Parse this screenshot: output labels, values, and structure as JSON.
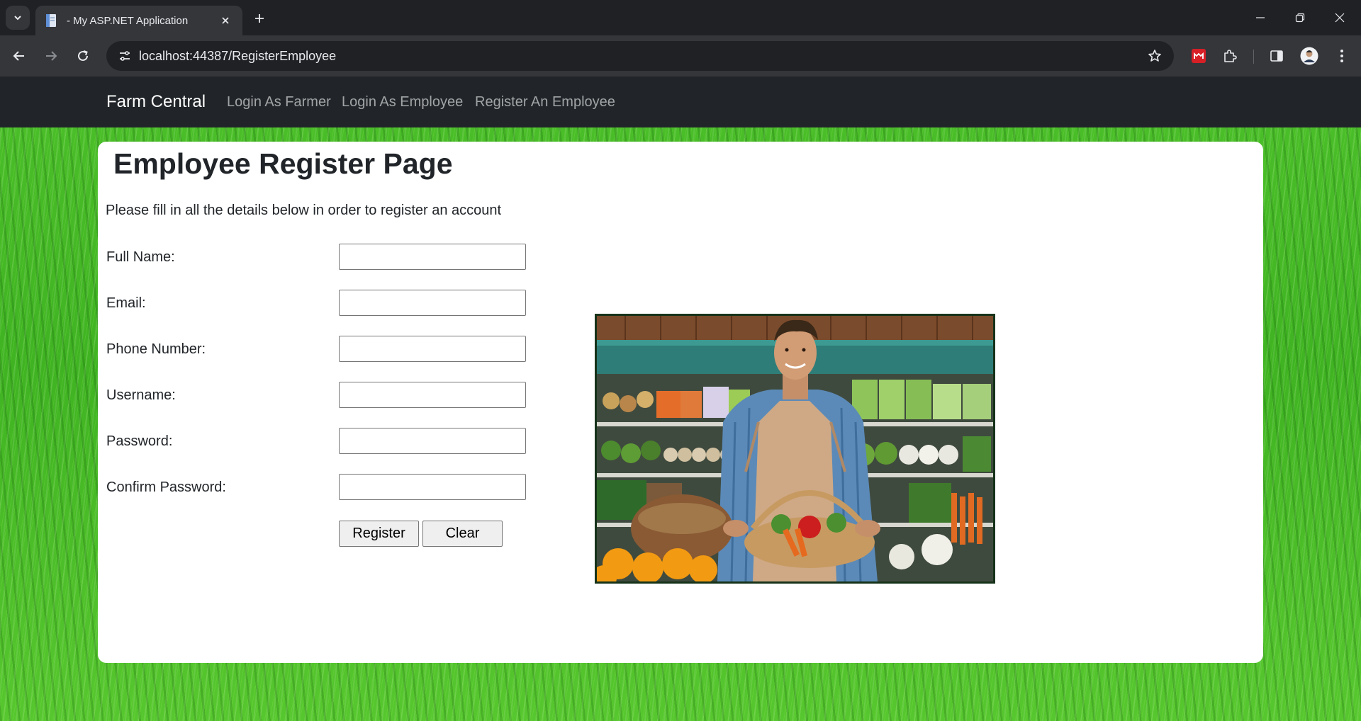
{
  "browser": {
    "tab_title": "- My ASP.NET Application",
    "url": "localhost:44387/RegisterEmployee"
  },
  "nav": {
    "brand": "Farm Central",
    "links": [
      "Login As Farmer",
      "Login As Employee",
      "Register An Employee"
    ]
  },
  "page": {
    "title": "Employee Register Page",
    "intro": "Please fill in all the details below in order to register an account",
    "fields": [
      {
        "label": "Full Name:",
        "value": ""
      },
      {
        "label": "Email:",
        "value": ""
      },
      {
        "label": "Phone Number:",
        "value": ""
      },
      {
        "label": "Username:",
        "value": ""
      },
      {
        "label": "Password:",
        "value": ""
      },
      {
        "label": "Confirm Password:",
        "value": ""
      }
    ],
    "register_label": "Register",
    "clear_label": "Clear"
  },
  "icons": {
    "tab_search": "chevron-down-icon",
    "favicon": "document-icon",
    "tab_close": "close-icon",
    "new_tab": "plus-icon",
    "back": "arrow-left-icon",
    "forward": "arrow-right-icon",
    "reload": "reload-icon",
    "site_info": "tune-icon",
    "bookmark": "star-icon",
    "extension_red": "mendeley-icon",
    "extensions": "puzzle-icon",
    "side_panel": "side-panel-icon",
    "profile": "avatar-icon",
    "menu": "kebab-menu-icon",
    "minimize": "minimize-icon",
    "restore": "restore-icon",
    "close_window": "close-window-icon"
  },
  "colors": {
    "navbar": "#212529",
    "chrome_dark": "#202124",
    "chrome_toolbar": "#35363a",
    "grass": "#3fb322",
    "card": "#ffffff"
  }
}
